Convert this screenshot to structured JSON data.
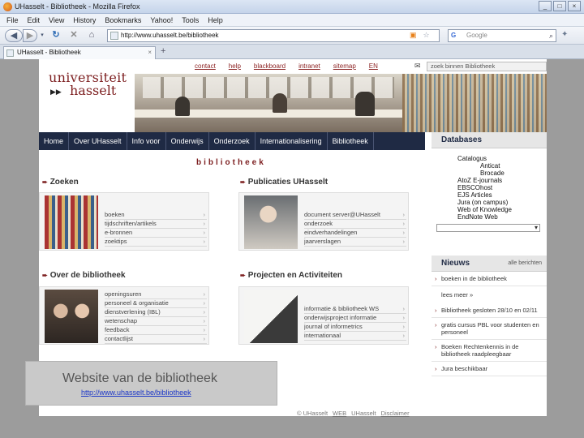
{
  "window": {
    "title": "UHasselt - Bibliotheek - Mozilla Firefox",
    "buttons": [
      "_",
      "□",
      "×"
    ]
  },
  "menu": [
    "File",
    "Edit",
    "View",
    "History",
    "Bookmarks",
    "Yahoo!",
    "Tools",
    "Help"
  ],
  "nav": {
    "url": "http://www.uhasselt.be/bibliotheek",
    "search_placeholder": "Google"
  },
  "tab": {
    "label": "UHasselt - Bibliotheek"
  },
  "site": {
    "logo_line1": "universiteit",
    "logo_line2": "hasselt",
    "toplinks": [
      "contact",
      "help",
      "blackboard",
      "intranet",
      "sitemap",
      "EN"
    ],
    "site_search": "zoek binnen Bibliotheek",
    "mainnav": [
      "Home",
      "Over UHasselt",
      "Info voor",
      "Onderwijs",
      "Onderzoek",
      "Internationalisering",
      "Bibliotheek"
    ],
    "page_title": "bibliotheek"
  },
  "sections": {
    "zoeken": {
      "title": "Zoeken",
      "items": [
        "boeken",
        "tijdschriften/artikels",
        "e-bronnen",
        "zoektips"
      ]
    },
    "publicaties": {
      "title": "Publicaties UHasselt",
      "items": [
        "document server@UHasselt",
        "onderzoek",
        "eindverhandelingen",
        "jaarverslagen"
      ]
    },
    "over": {
      "title": "Over de bibliotheek",
      "items": [
        "openingsuren",
        "personeel & organisatie",
        "dienstverlening (IBL)",
        "wetenschap",
        "feedback",
        "contactlijst"
      ]
    },
    "projecten": {
      "title": "Projecten en Activiteiten",
      "items": [
        "informatie & bibliotheek WS",
        "onderwijsproject informatie",
        "journal of informetrics",
        "internationaal"
      ]
    }
  },
  "sidebar": {
    "databases_title": "Databases",
    "databases": [
      "Catalogus",
      "Anticat",
      "Brocade",
      "AtoZ E-journals",
      "EBSCOhost",
      "EJS Articles",
      "Jura (on campus)",
      "Web of Knowledge",
      "EndNote Web"
    ],
    "news_title": "Nieuws",
    "news_right": "alle berichten",
    "news_items": [
      "boeken in de bibliotheek",
      "Bibliotheek gesloten 28/10 en 02/11",
      "gratis cursus PBL voor studenten en personeel",
      "Boeken Rechtenkennis in de bibliotheek raadpleegbaar",
      "Jura beschikbaar"
    ],
    "news_more": "lees meer »"
  },
  "caption": {
    "title": "Website van de bibliotheek",
    "url": "http://www.uhasselt.be/bibliotheek"
  },
  "footer": {
    "copyright": "© UHasselt",
    "web_link": "WEB",
    "mid": "UHasselt",
    "disclaimer": "Disclaimer"
  }
}
